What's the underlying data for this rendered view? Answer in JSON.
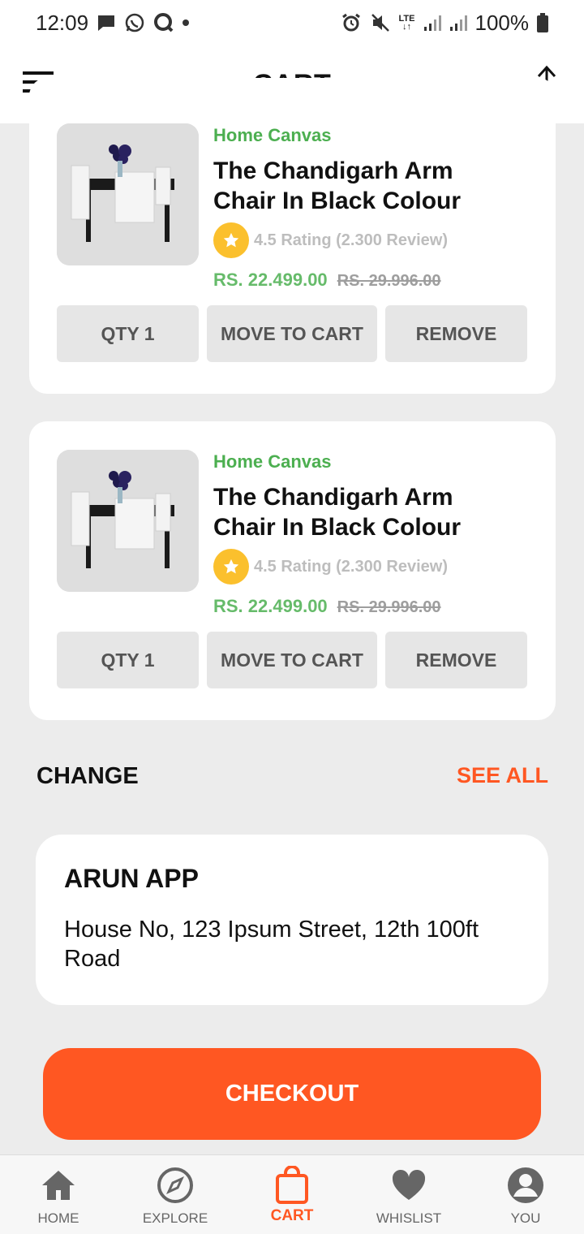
{
  "status_bar": {
    "time": "12:09",
    "battery": "100%"
  },
  "header": {
    "title": "CART"
  },
  "cart_items": [
    {
      "brand": "Home Canvas",
      "name_line1": "The Chandigarh Arm",
      "name_line2": "Chair In Black Colour",
      "rating": "4.5 Rating (2.300 Review)",
      "price": "RS. 22.499.00",
      "old_price": "RS. 29.996.00",
      "qty_label": "QTY 1",
      "move_label": "MOVE TO CART",
      "remove_label": "REMOVE"
    },
    {
      "brand": "Home Canvas",
      "name_line1": "The Chandigarh Arm",
      "name_line2": "Chair In Black Colour",
      "rating": "4.5 Rating (2.300 Review)",
      "price": "RS. 22.499.00",
      "old_price": "RS. 29.996.00",
      "qty_label": "QTY 1",
      "move_label": "MOVE TO CART",
      "remove_label": "REMOVE"
    }
  ],
  "address_section": {
    "title": "CHANGE",
    "see_all": "SEE ALL",
    "name": "ARUN APP",
    "line": "House No, 123 Ipsum Street, 12th 100ft Road"
  },
  "checkout_label": "CHECKOUT",
  "bottom_nav": {
    "items": [
      {
        "label": "HOME",
        "icon": "home-icon"
      },
      {
        "label": "EXPLORE",
        "icon": "compass-icon"
      },
      {
        "label": "CART",
        "icon": "bag-icon"
      },
      {
        "label": "WHISLIST",
        "icon": "heart-icon"
      },
      {
        "label": "YOU",
        "icon": "user-icon"
      }
    ],
    "active": "CART"
  },
  "colors": {
    "accent": "#ff5722",
    "brand_green": "#4caf50",
    "price_green": "#66bb6a",
    "star": "#fbc02d",
    "background": "#ececec"
  }
}
